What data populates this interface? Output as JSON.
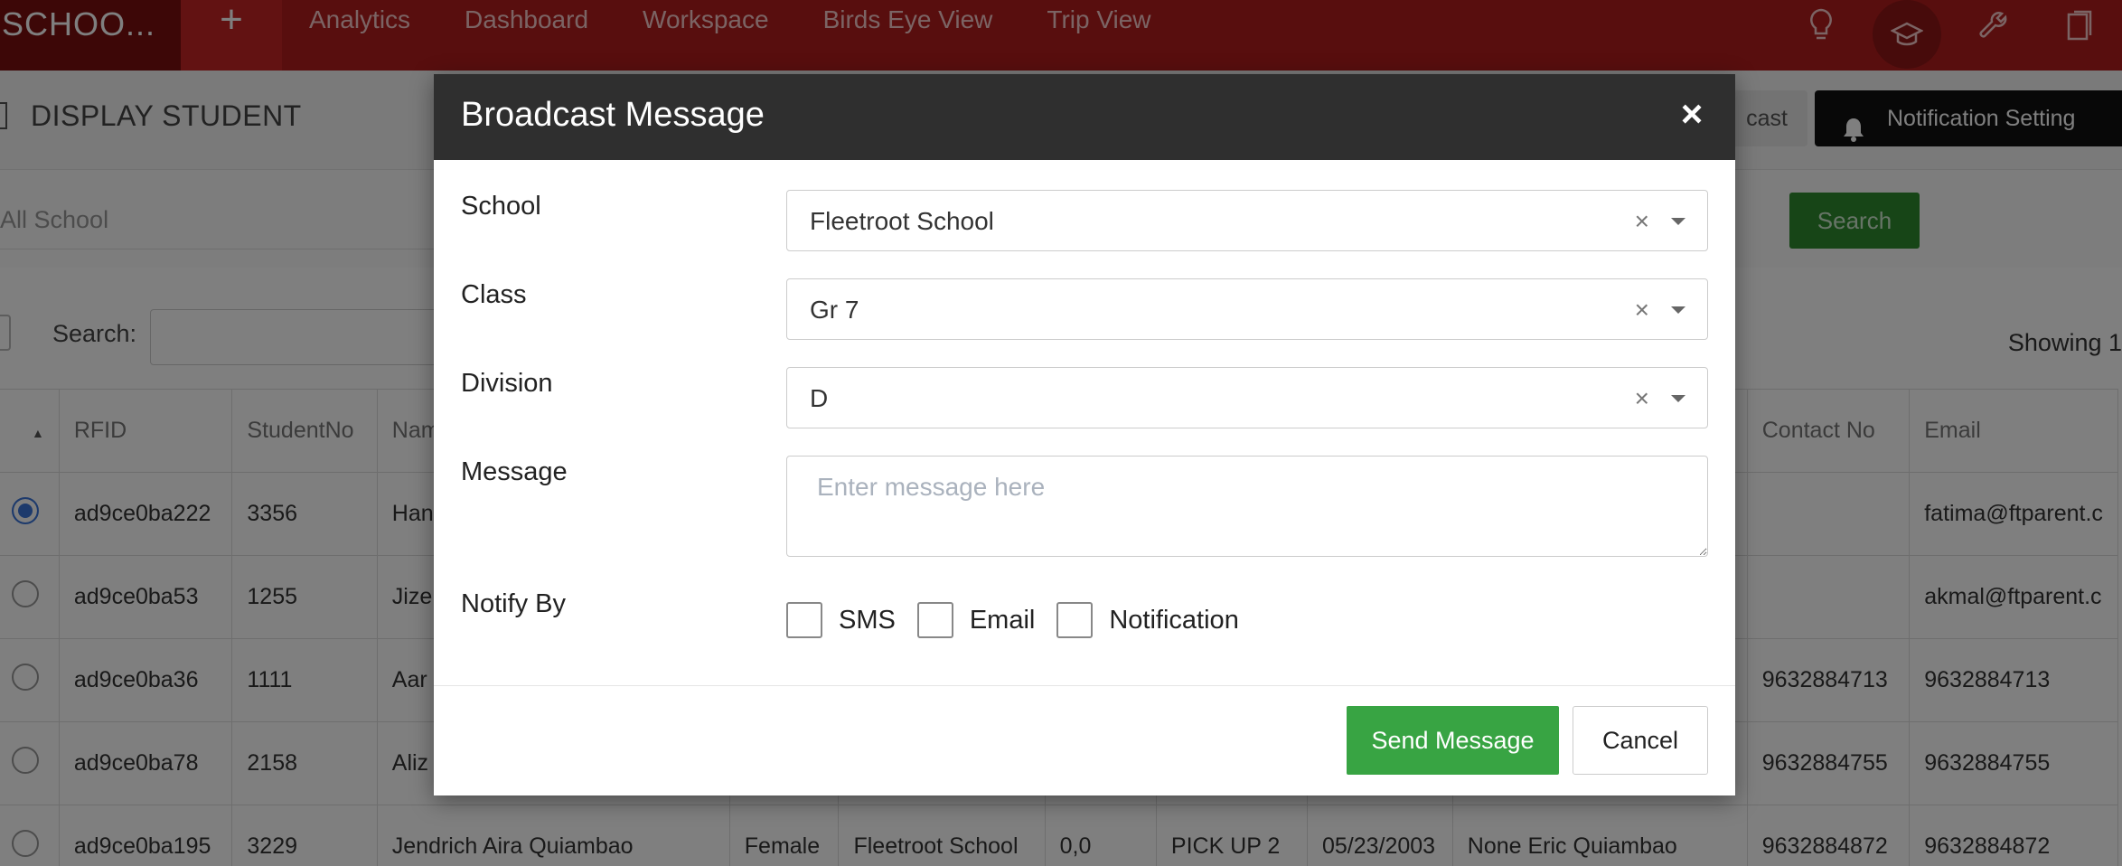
{
  "topbar": {
    "brand": "SCHOO...",
    "add_symbol": "+",
    "nav": [
      "Analytics",
      "Dashboard",
      "Workspace",
      "Birds Eye View",
      "Trip View"
    ],
    "icons": [
      "lightbulb-icon",
      "graduation-cap-icon",
      "wrench-icon",
      "clipboard-icon"
    ]
  },
  "page": {
    "title": "DISPLAY STUDENT",
    "broadcast_label": "cast",
    "notification_setting_label": "Notification Setting",
    "school_filter": "All School",
    "search_button": "Search",
    "search_label": "Search:",
    "showing_text": "Showing 1"
  },
  "table": {
    "headers": [
      "",
      "RFID",
      "StudentNo",
      "Nam",
      "",
      "",
      "",
      "",
      "",
      "",
      "Contact No",
      "Email"
    ],
    "rows": [
      {
        "rfid": "ad9ce0ba222",
        "student_no": "3356",
        "name": "Han",
        "gender": "",
        "school": "",
        "coords": "",
        "pickup": "",
        "dob": "",
        "parent": "",
        "contact": "",
        "email": "fatima@ftparent.c",
        "selected": true
      },
      {
        "rfid": "ad9ce0ba53",
        "student_no": "1255",
        "name": "Jize",
        "gender": "",
        "school": "",
        "coords": "",
        "pickup": "",
        "dob": "",
        "parent": "",
        "contact": "",
        "email": "akmal@ftparent.c",
        "selected": false
      },
      {
        "rfid": "ad9ce0ba36",
        "student_no": "1111",
        "name": "Aar",
        "gender": "",
        "school": "",
        "coords": "",
        "pickup": "",
        "dob": "",
        "parent": "",
        "contact": "9632884713",
        "email": "9632884713",
        "selected": false
      },
      {
        "rfid": "ad9ce0ba78",
        "student_no": "2158",
        "name": "Aliz",
        "gender": "",
        "school": "",
        "coords": "",
        "pickup": "",
        "dob": "",
        "parent": "",
        "contact": "9632884755",
        "email": "9632884755",
        "selected": false
      },
      {
        "rfid": "ad9ce0ba195",
        "student_no": "3229",
        "name": "Jendrich Aira Quiambao",
        "gender": "Female",
        "school": "Fleetroot School",
        "coords": "0,0",
        "pickup": "PICK UP 2",
        "dob": "05/23/2003",
        "parent": "None Eric Quiambao",
        "contact": "9632884872",
        "email": "9632884872",
        "selected": false
      }
    ]
  },
  "modal": {
    "title": "Broadcast Message",
    "close_symbol": "×",
    "school_label": "School",
    "school_value": "Fleetroot School",
    "class_label": "Class",
    "class_value": "Gr 7",
    "division_label": "Division",
    "division_value": "D",
    "clear_symbol": "×",
    "message_label": "Message",
    "message_placeholder": "Enter message here",
    "notify_label": "Notify By",
    "notify_options": [
      "SMS",
      "Email",
      "Notification"
    ],
    "send_label": "Send Message",
    "cancel_label": "Cancel"
  }
}
